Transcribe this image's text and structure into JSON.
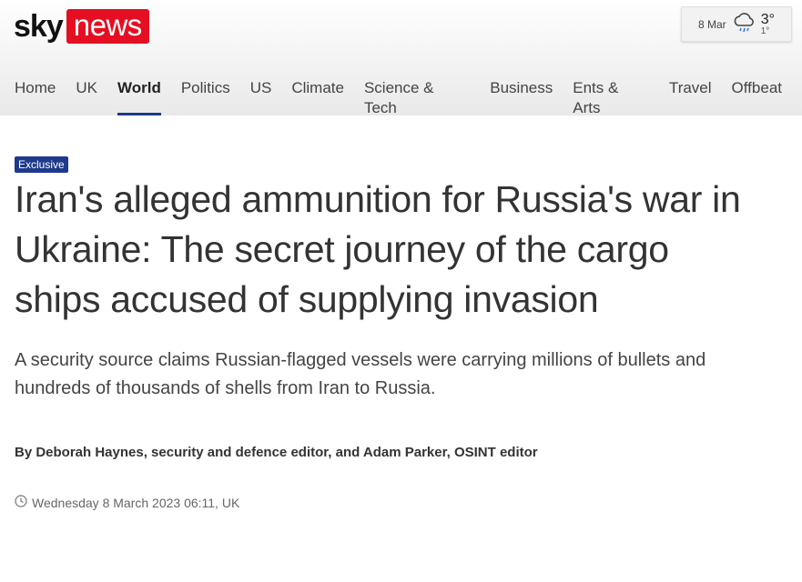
{
  "brand": {
    "sky": "sky",
    "news": "news",
    "accent": "#e40f22",
    "nav_accent": "#1a3a8a"
  },
  "weather": {
    "date": "8 Mar",
    "icon": "cloud-rain-icon",
    "high": "3°",
    "low": "1°"
  },
  "nav": {
    "items": [
      {
        "label": "Home"
      },
      {
        "label": "UK"
      },
      {
        "label": "World",
        "active": true
      },
      {
        "label": "Politics"
      },
      {
        "label": "US"
      },
      {
        "label": "Climate"
      },
      {
        "label": "Science & Tech"
      },
      {
        "label": "Business"
      },
      {
        "label": "Ents & Arts"
      },
      {
        "label": "Travel"
      },
      {
        "label": "Offbeat"
      }
    ]
  },
  "article": {
    "badge": "Exclusive",
    "badge_color": "#1e3a8a",
    "headline": "Iran's alleged ammunition for Russia's war in Ukraine: The secret journey of the cargo ships accused of supplying invasion",
    "standfirst": "A security source claims Russian-flagged vessels were carrying millions of bullets and hundreds of thousands of shells from Iran to Russia.",
    "byline": "By Deborah Haynes, security and defence editor, and Adam Parker, OSINT editor",
    "date": "Wednesday 8 March 2023 06:11, UK"
  }
}
